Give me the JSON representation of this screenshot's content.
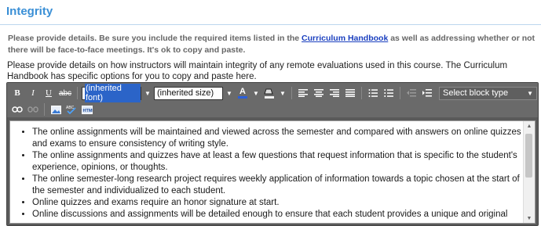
{
  "section": {
    "title": "Integrity"
  },
  "guidance": {
    "text_before": "Please provide details. Be sure you include the required items listed in the ",
    "link_text": "Curriculum Handbook",
    "text_after": " as well as addressing whether or not there will be face-to-face meetings. It's ok to copy and paste."
  },
  "question": {
    "text": "Please provide details on how instructors will maintain integrity of any remote evaluations used in this course. The Curriculum Handbook has specific options for you to copy and paste here."
  },
  "toolbar": {
    "bold": "B",
    "italic": "I",
    "underline": "U",
    "strike": "abc",
    "font_value": "(inherited font)",
    "size_value": "(inherited size)",
    "text_color_letter": "A",
    "text_color": "#2b5fd9",
    "highlight_color": "#f2f2f2",
    "block_type": "Select block type"
  },
  "content": {
    "items": [
      "The online assignments will be maintained and viewed across the semester and compared with answers on online quizzes and exams to ensure consistency of writing style.",
      "The online assignments and quizzes have at least a few questions that request information that is specific to the student's experience, opinions, or thoughts.",
      "The online semester-long research project requires weekly application of information towards a topic chosen at the start of the semester and individualized to each student.",
      "Online quizzes and exams require an honor signature at start.",
      "Online discussions and assignments will be detailed enough to ensure that each student provides a unique and original"
    ]
  }
}
